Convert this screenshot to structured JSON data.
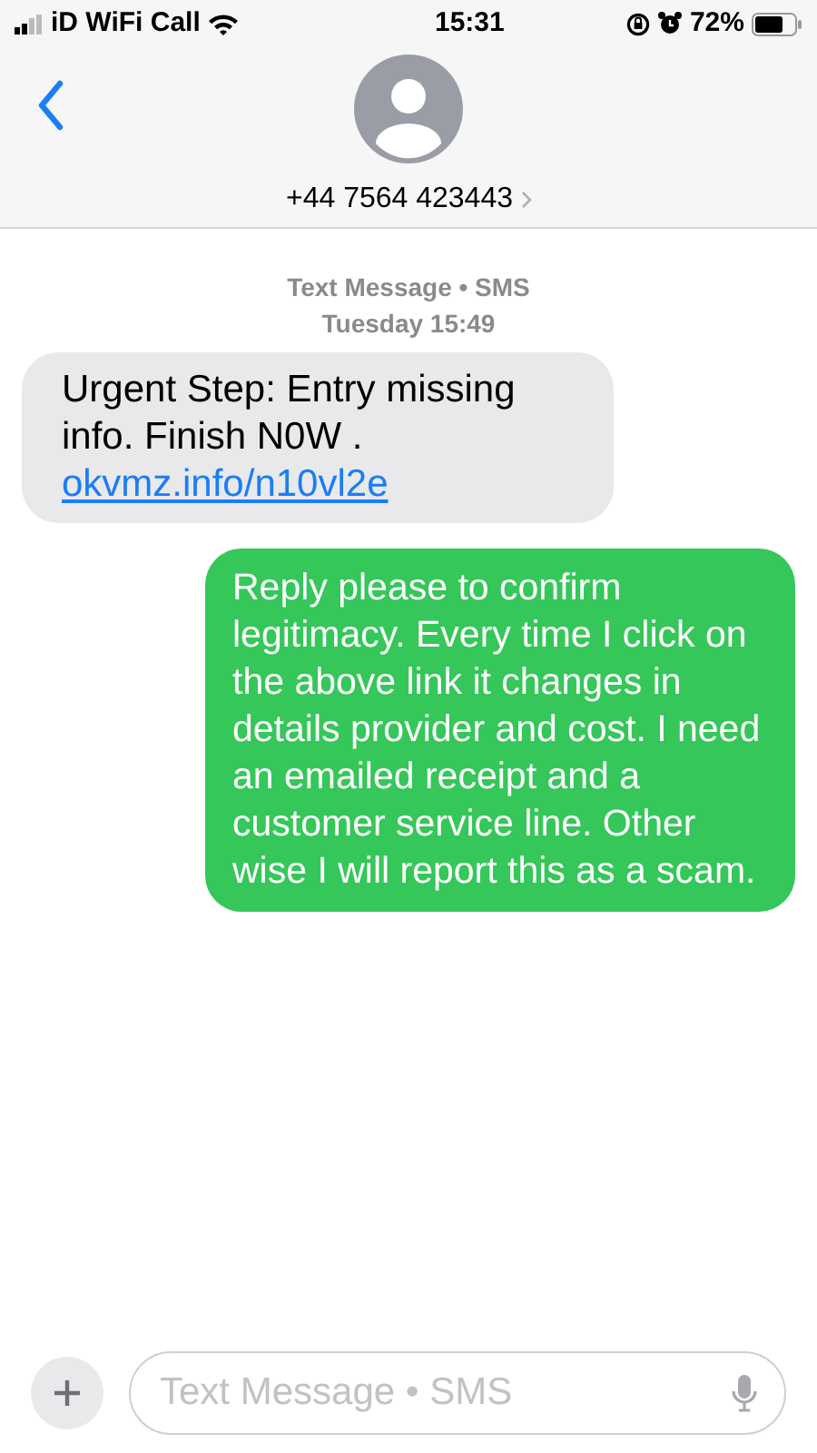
{
  "status_bar": {
    "carrier": "iD WiFi Call",
    "time": "15:31",
    "battery": "72%"
  },
  "header": {
    "contact": "+44 7564 423443"
  },
  "thread": {
    "service": "Text Message • SMS",
    "timestamp": "Tuesday 15:49"
  },
  "messages": [
    {
      "kind": "incoming",
      "text": "Urgent Step: Entry missing info. Finish N0W .",
      "link": "okvmz.info/n10vl2e"
    },
    {
      "kind": "outgoing",
      "text": "Reply please to confirm legitimacy. Every time I click on the above link it changes in details provider and cost. I need an emailed receipt and a customer service line. Other wise I will report this as a scam."
    }
  ],
  "composer": {
    "placeholder": "Text Message • SMS"
  }
}
